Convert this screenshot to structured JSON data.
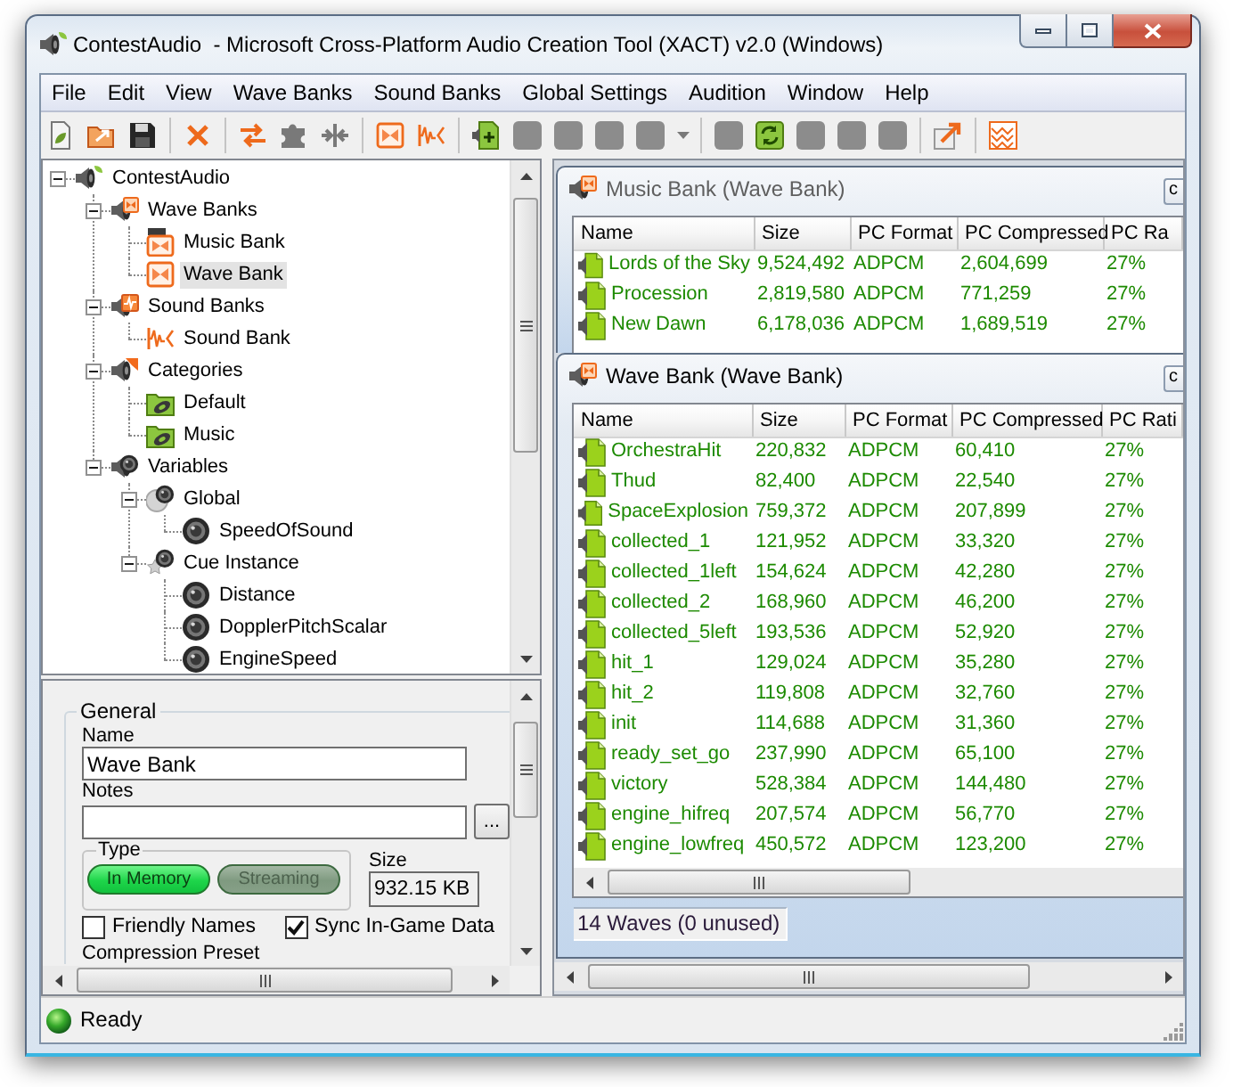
{
  "window": {
    "title": "ContestAudio  - Microsoft Cross-Platform Audio Creation Tool (XACT) v2.0 (Windows)"
  },
  "menu": [
    "File",
    "Edit",
    "View",
    "Wave Banks",
    "Sound Banks",
    "Global Settings",
    "Audition",
    "Window",
    "Help"
  ],
  "toolbar": [
    [
      {
        "kind": "new",
        "disabled": false
      },
      {
        "kind": "open",
        "disabled": false
      },
      {
        "kind": "save",
        "disabled": false
      }
    ],
    [
      {
        "kind": "delete",
        "disabled": false
      }
    ],
    [
      {
        "kind": "swap",
        "disabled": false
      },
      {
        "kind": "puzzle",
        "disabled": true
      },
      {
        "kind": "merge",
        "disabled": true
      }
    ],
    [
      {
        "kind": "wave-bank",
        "disabled": false
      },
      {
        "kind": "sound-bank",
        "disabled": false
      }
    ],
    [
      {
        "kind": "add-wave",
        "disabled": false
      },
      {
        "kind": "blank",
        "disabled": true
      },
      {
        "kind": "blank",
        "disabled": true
      },
      {
        "kind": "blank",
        "disabled": true
      },
      {
        "kind": "blank",
        "disabled": true
      },
      {
        "kind": "dropdown-arrow",
        "disabled": true
      }
    ],
    [
      {
        "kind": "blank",
        "disabled": true
      },
      {
        "kind": "refresh",
        "disabled": false
      },
      {
        "kind": "blank",
        "disabled": true
      },
      {
        "kind": "blank",
        "disabled": true
      },
      {
        "kind": "blank",
        "disabled": true
      }
    ],
    [
      {
        "kind": "export",
        "disabled": false
      }
    ],
    [
      {
        "kind": "pattern",
        "disabled": false
      }
    ]
  ],
  "project_tree": [
    {
      "label": "ContestAudio",
      "kind": "project",
      "expanded": true,
      "selected": false,
      "children": [
        {
          "label": "Wave Banks",
          "kind": "wave-banks",
          "expanded": true,
          "selected": false,
          "children": [
            {
              "label": "Music Bank",
              "kind": "dvd-wave-bank",
              "selected": false
            },
            {
              "label": "Wave Bank",
              "kind": "wave-bank",
              "selected": true
            }
          ]
        },
        {
          "label": "Sound Banks",
          "kind": "sound-banks",
          "expanded": true,
          "selected": false,
          "children": [
            {
              "label": "Sound Bank",
              "kind": "sound-bank",
              "selected": false
            }
          ]
        },
        {
          "label": "Categories",
          "kind": "categories",
          "expanded": true,
          "selected": false,
          "children": [
            {
              "label": "Default",
              "kind": "category",
              "selected": false
            },
            {
              "label": "Music",
              "kind": "category",
              "selected": false
            }
          ]
        },
        {
          "label": "Variables",
          "kind": "variables",
          "expanded": true,
          "selected": false,
          "children": [
            {
              "label": "Global",
              "kind": "global-variables",
              "expanded": true,
              "selected": false,
              "children": [
                {
                  "label": "SpeedOfSound",
                  "kind": "variable",
                  "selected": false
                }
              ]
            },
            {
              "label": "Cue Instance",
              "kind": "instance-variables",
              "expanded": true,
              "selected": false,
              "children": [
                {
                  "label": "Distance",
                  "kind": "variable",
                  "selected": false
                },
                {
                  "label": "DopplerPitchScalar",
                  "kind": "variable",
                  "selected": false
                },
                {
                  "label": "EngineSpeed",
                  "kind": "variable",
                  "selected": false
                }
              ]
            }
          ]
        }
      ]
    }
  ],
  "properties": {
    "group_title": "General",
    "name_label": "Name",
    "name_value": "Wave Bank",
    "notes_label": "Notes",
    "browse_button": "...",
    "type_label": "Type",
    "type_options": [
      {
        "label": "In Memory",
        "selected": true
      },
      {
        "label": "Streaming",
        "selected": false
      }
    ],
    "size_label": "Size",
    "size_value": "932.15 KB",
    "checkboxes": [
      {
        "label": "Friendly Names",
        "checked": false
      },
      {
        "label": "Sync In-Game Data",
        "checked": true
      }
    ],
    "next_label": "Compression Preset"
  },
  "documents": [
    {
      "title": "Music Bank (Wave Bank)",
      "active": false,
      "title_button": "c",
      "columns": [
        "Name",
        "Size",
        "PC Format",
        "PC Compressed",
        "PC Ra"
      ],
      "rows": [
        {
          "cells": [
            "Lords of the Sky",
            "9,524,492",
            "ADPCM",
            "2,604,699",
            "27%"
          ],
          "selected": false
        },
        {
          "cells": [
            "Procession",
            "2,819,580",
            "ADPCM",
            "771,259",
            "27%"
          ],
          "selected": false
        },
        {
          "cells": [
            "New Dawn",
            "6,178,036",
            "ADPCM",
            "1,689,519",
            "27%"
          ],
          "selected": false
        }
      ]
    },
    {
      "title": "Wave Bank (Wave Bank)",
      "active": true,
      "title_button": "c",
      "columns": [
        "Name",
        "Size",
        "PC Format",
        "PC Compressed",
        "PC Rati"
      ],
      "rows": [
        {
          "cells": [
            "OrchestraHit",
            "220,832",
            "ADPCM",
            "60,410",
            "27%"
          ],
          "selected": false
        },
        {
          "cells": [
            "Thud",
            "82,400",
            "ADPCM",
            "22,540",
            "27%"
          ],
          "selected": false
        },
        {
          "cells": [
            "SpaceExplosion",
            "759,372",
            "ADPCM",
            "207,899",
            "27%"
          ],
          "selected": false
        },
        {
          "cells": [
            "collected_1",
            "121,952",
            "ADPCM",
            "33,320",
            "27%"
          ],
          "selected": false
        },
        {
          "cells": [
            "collected_1left",
            "154,624",
            "ADPCM",
            "42,280",
            "27%"
          ],
          "selected": false
        },
        {
          "cells": [
            "collected_2",
            "168,960",
            "ADPCM",
            "46,200",
            "27%"
          ],
          "selected": false
        },
        {
          "cells": [
            "collected_5left",
            "193,536",
            "ADPCM",
            "52,920",
            "27%"
          ],
          "selected": false
        },
        {
          "cells": [
            "hit_1",
            "129,024",
            "ADPCM",
            "35,280",
            "27%"
          ],
          "selected": false
        },
        {
          "cells": [
            "hit_2",
            "119,808",
            "ADPCM",
            "32,760",
            "27%"
          ],
          "selected": false
        },
        {
          "cells": [
            "init",
            "114,688",
            "ADPCM",
            "31,360",
            "27%"
          ],
          "selected": false
        },
        {
          "cells": [
            "ready_set_go",
            "237,990",
            "ADPCM",
            "65,100",
            "27%"
          ],
          "selected": false
        },
        {
          "cells": [
            "victory",
            "528,384",
            "ADPCM",
            "144,480",
            "27%"
          ],
          "selected": false
        },
        {
          "cells": [
            "engine_hifreq",
            "207,574",
            "ADPCM",
            "56,770",
            "27%"
          ],
          "selected": false
        },
        {
          "cells": [
            "engine_lowfreq",
            "450,572",
            "ADPCM",
            "123,200",
            "27%"
          ],
          "selected": false
        }
      ],
      "status": "14 Waves (0 unused)"
    }
  ],
  "status_bar": {
    "text": "Ready"
  }
}
